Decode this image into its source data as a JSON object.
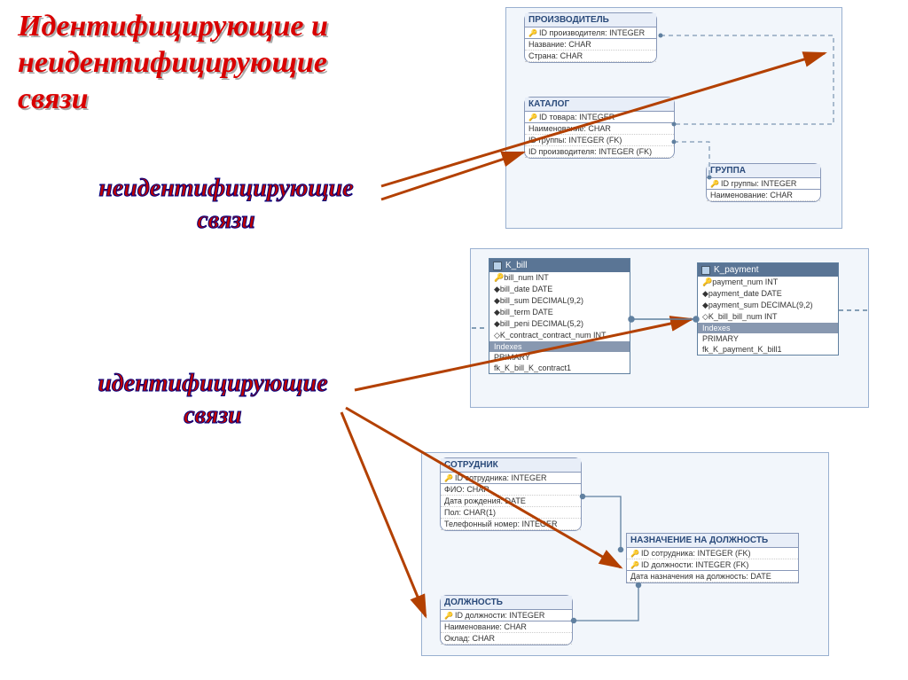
{
  "title_lines": [
    "Идентифицирующие и",
    "неидентифицирующие",
    "связи"
  ],
  "label_nonident": "неидентифицирующие\nсвязи",
  "label_ident": "идентифицирующие\nсвязи",
  "diagram_top": {
    "producer": {
      "name": "ПРОИЗВОДИТЕЛЬ",
      "pk": "ID производителя: INTEGER",
      "attrs": [
        "Название: CHAR",
        "Страна: CHAR"
      ]
    },
    "catalog": {
      "name": "КАТАЛОГ",
      "pk": "ID товара: INTEGER",
      "attrs": [
        "Наименование: CHAR",
        "ID группы: INTEGER (FK)",
        "ID производителя: INTEGER (FK)"
      ]
    },
    "group": {
      "name": "ГРУППА",
      "pk": "ID группы: INTEGER",
      "attrs": [
        "Наименование: CHAR"
      ]
    }
  },
  "diagram_mid": {
    "kbill": {
      "name": "K_bill",
      "cols": [
        "bill_num INT",
        "bill_date DATE",
        "bill_sum DECIMAL(9,2)",
        "bill_term DATE",
        "bill_peni DECIMAL(5,2)",
        "K_contract_contract_num INT"
      ],
      "indexes_label": "Indexes",
      "indexes": [
        "PRIMARY",
        "fk_K_bill_K_contract1"
      ]
    },
    "kpayment": {
      "name": "K_payment",
      "cols": [
        "payment_num INT",
        "payment_date DATE",
        "payment_sum DECIMAL(9,2)",
        "K_bill_bill_num INT"
      ],
      "indexes_label": "Indexes",
      "indexes": [
        "PRIMARY",
        "fk_K_payment_K_bill1"
      ]
    }
  },
  "diagram_bot": {
    "employee": {
      "name": "СОТРУДНИК",
      "pk": "ID сотрудника: INTEGER",
      "attrs": [
        "ФИО: CHAR",
        "Дата рождения: DATE",
        "Пол: CHAR(1)",
        "Телефонный номер: INTEGER"
      ]
    },
    "assignment": {
      "name": "НАЗНАЧЕНИЕ НА ДОЛЖНОСТЬ",
      "pk": [
        "ID сотрудника: INTEGER (FK)",
        "ID должности: INTEGER (FK)"
      ],
      "attrs": [
        "Дата назначения на должность: DATE"
      ]
    },
    "position": {
      "name": "ДОЛЖНОСТЬ",
      "pk": "ID должности: INTEGER",
      "attrs": [
        "Наименование: CHAR",
        "Оклад: CHAR"
      ]
    }
  }
}
